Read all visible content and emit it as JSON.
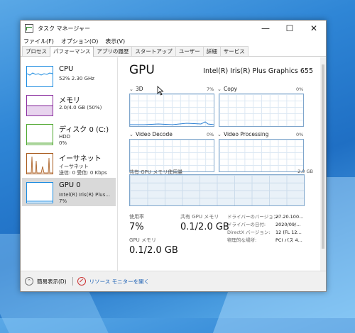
{
  "window": {
    "title": "タスク マネージャー",
    "controls": {
      "minimize": "—",
      "maximize": "☐",
      "close": "✕"
    }
  },
  "menu": [
    "ファイル(F)",
    "オプション(O)",
    "表示(V)"
  ],
  "tabs": [
    {
      "label": "プロセス",
      "active": false
    },
    {
      "label": "パフォーマンス",
      "active": true
    },
    {
      "label": "アプリの履歴",
      "active": false
    },
    {
      "label": "スタートアップ",
      "active": false
    },
    {
      "label": "ユーザー",
      "active": false
    },
    {
      "label": "詳細",
      "active": false
    },
    {
      "label": "サービス",
      "active": false
    }
  ],
  "sidebar": [
    {
      "title": "CPU",
      "lines": [
        "52%  2.30 GHz"
      ],
      "color": "#1b8be0"
    },
    {
      "title": "メモリ",
      "lines": [
        "2.0/4.0 GB (50%)"
      ],
      "color": "#8a2c9e"
    },
    {
      "title": "ディスク 0 (C:)",
      "lines": [
        "HDD",
        "0%"
      ],
      "color": "#4ea72e"
    },
    {
      "title": "イーサネット",
      "lines": [
        "イーサネット",
        "送信: 0 受信: 0 Kbps"
      ],
      "color": "#a7591b"
    },
    {
      "title": "GPU 0",
      "lines": [
        "Intel(R) Iris(R) Plus...",
        "7%"
      ],
      "color": "#1b8be0",
      "selected": true
    }
  ],
  "main": {
    "title": "GPU",
    "model": "Intel(R) Iris(R) Plus Graphics 655",
    "graphs": [
      {
        "label": "3D",
        "percent": "7%"
      },
      {
        "label": "Copy",
        "percent": "0%"
      },
      {
        "label": "Video Decode",
        "percent": "0%"
      },
      {
        "label": "Video Processing",
        "percent": "0%"
      }
    ],
    "shared_label": "共有 GPU メモリ使用量",
    "shared_max": "2.0 GB",
    "stats": {
      "utilization_label": "使用率",
      "utilization": "7%",
      "shared_mem_label": "共有 GPU メモリ",
      "shared_mem": "0.1/2.0 GB",
      "gpu_mem_label": "GPU メモリ",
      "gpu_mem": "0.1/2.0 GB"
    },
    "details": [
      {
        "k": "ドライバーのバージョン:",
        "v": "27.20.100..."
      },
      {
        "k": "ドライバーの日付:",
        "v": "2020/09/..."
      },
      {
        "k": "DirectX バージョン:",
        "v": "12 (FL 12..."
      },
      {
        "k": "物理的な場所:",
        "v": "PCI バス 4..."
      }
    ]
  },
  "footer": {
    "brief": "簡易表示(D)",
    "monitor_link": "リソース モニターを開く"
  }
}
